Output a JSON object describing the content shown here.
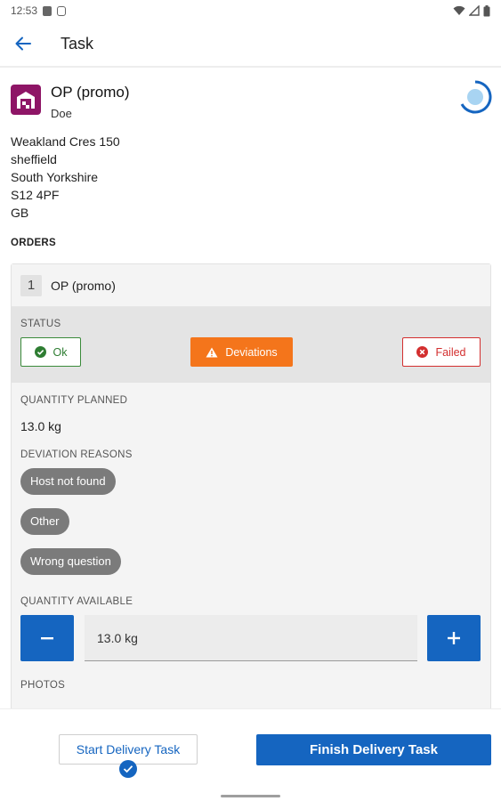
{
  "status_bar": {
    "time": "12:53"
  },
  "app_bar": {
    "title": "Task"
  },
  "task": {
    "title": "OP (promo)",
    "subtitle": "Doe",
    "address": [
      "Weakland Cres 150",
      "sheffield",
      "South Yorkshire",
      "S12 4PF",
      "GB"
    ]
  },
  "orders": {
    "section_label": "ORDERS",
    "order": {
      "number": "1",
      "name": "OP (promo)",
      "status_label": "STATUS",
      "status_options": {
        "ok": "Ok",
        "deviations": "Deviations",
        "failed": "Failed"
      },
      "quantity_planned_label": "QUANTITY PLANNED",
      "quantity_planned": "13.0 kg",
      "deviation_reasons_label": "DEVIATION REASONS",
      "deviation_reasons": [
        "Host not found",
        "Other",
        "Wrong question"
      ],
      "quantity_available_label": "QUANTITY AVAILABLE",
      "quantity_available": "13.0 kg",
      "photos_label": "PHOTOS"
    }
  },
  "actions": {
    "start_label": "Start Delivery Task",
    "finish_label": "Finish Delivery Task"
  },
  "colors": {
    "primary": "#1565c0",
    "deviation": "#f4751b",
    "ok": "#2e7d32",
    "failed": "#d32f2f",
    "task_icon_bg": "#8e1566"
  },
  "icons": [
    "back-arrow-icon",
    "warehouse-icon",
    "progress-ring-icon",
    "check-circle-icon",
    "warning-icon",
    "error-circle-icon",
    "minus-icon",
    "plus-icon",
    "checkmark-icon"
  ]
}
